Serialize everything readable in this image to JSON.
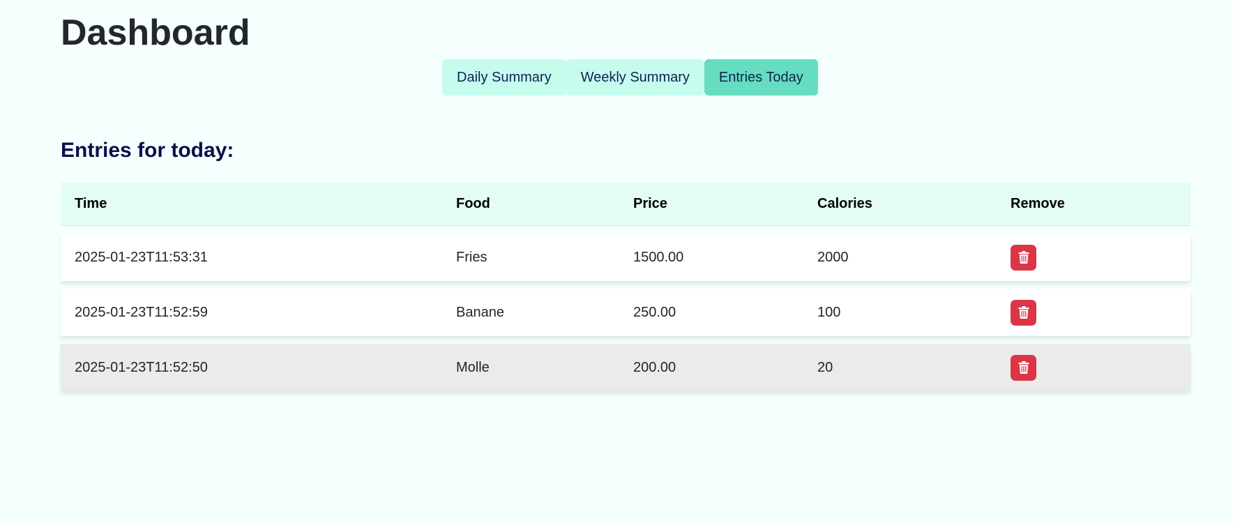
{
  "page": {
    "title": "Dashboard"
  },
  "tabs": [
    {
      "label": "Daily Summary",
      "active": false
    },
    {
      "label": "Weekly Summary",
      "active": false
    },
    {
      "label": "Entries Today",
      "active": true
    }
  ],
  "section": {
    "heading": "Entries for today:"
  },
  "table": {
    "headers": {
      "time": "Time",
      "food": "Food",
      "price": "Price",
      "calories": "Calories",
      "remove": "Remove"
    },
    "rows": [
      {
        "time": "2025-01-23T11:53:31",
        "food": "Fries",
        "price": "1500.00",
        "calories": "2000",
        "remove_icon": "trash-icon"
      },
      {
        "time": "2025-01-23T11:52:59",
        "food": "Banane",
        "price": "250.00",
        "calories": "100",
        "remove_icon": "trash-icon"
      },
      {
        "time": "2025-01-23T11:52:50",
        "food": "Molle",
        "price": "200.00",
        "calories": "20",
        "remove_icon": "trash-icon"
      }
    ]
  },
  "colors": {
    "background": "#f5fffd",
    "tab": "#c6fcee",
    "tab_active": "#66ddc1",
    "table_header": "#e3fcf5",
    "danger": "#dc3545",
    "selected_row": "#ebebeb"
  }
}
